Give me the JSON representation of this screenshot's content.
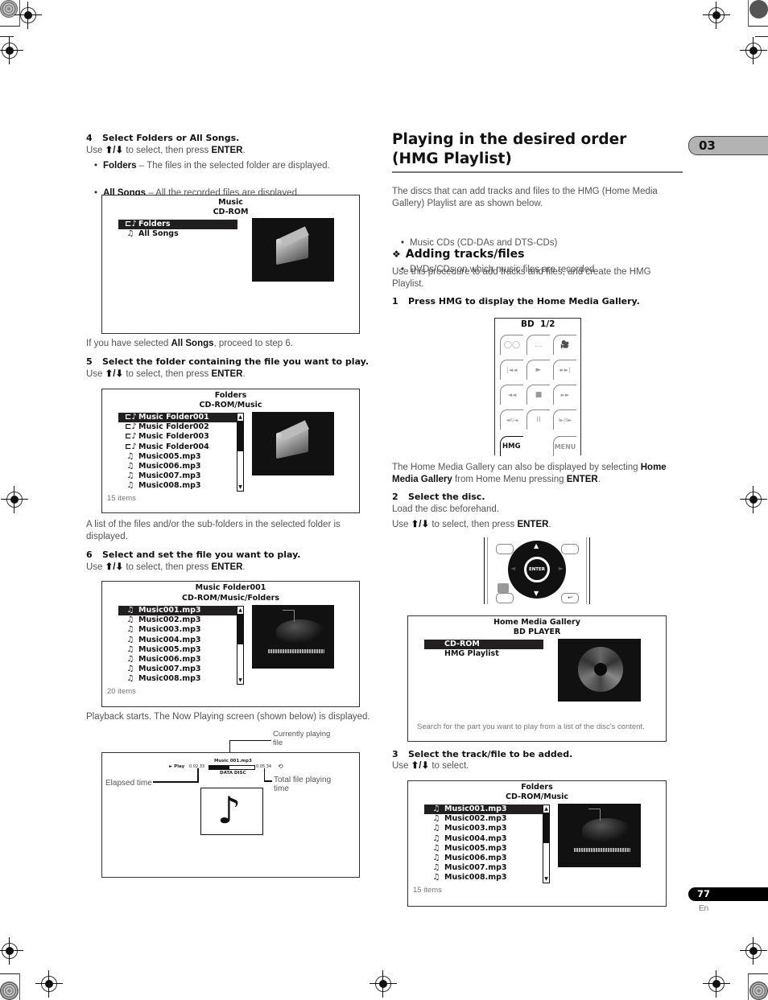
{
  "chapter_tab": "03",
  "page_number": "77",
  "page_lang": "En",
  "left": {
    "step4": {
      "num": "4",
      "title": "Select Folders or All Songs.",
      "use_pre": "Use ",
      "arrows": "⬆/⬇",
      "use_post": " to select, then press ",
      "enter": "ENTER",
      "period": ".",
      "bullets": [
        {
          "term": "Folders",
          "desc": " – The files in the selected folder are displayed."
        },
        {
          "term": "All Songs",
          "desc": " – All the recorded files are displayed."
        }
      ]
    },
    "screen1": {
      "title1": "Music",
      "title2": "CD-ROM",
      "items": [
        {
          "icon": "folder-music",
          "glyph": "🗀",
          "label": "Folders",
          "selected": true
        },
        {
          "icon": "music-note",
          "glyph": "♫",
          "label": "All Songs",
          "selected": false
        }
      ]
    },
    "note_all_songs": {
      "pre": "If you have selected ",
      "bold": "All Songs",
      "post": ", proceed to step 6."
    },
    "step5": {
      "num": "5",
      "title": "Select the folder containing the file you want to play.",
      "use_pre": "Use ",
      "arrows": "⬆/⬇",
      "use_post": " to select, then press ",
      "enter": "ENTER",
      "period": "."
    },
    "screen2": {
      "title1": "Folders",
      "title2": "CD-ROM/Music",
      "items": [
        {
          "icon": "folder-music",
          "label": "Music Folder001",
          "selected": true
        },
        {
          "icon": "folder-music",
          "label": "Music Folder002",
          "selected": false
        },
        {
          "icon": "folder-music",
          "label": "Music Folder003",
          "selected": false
        },
        {
          "icon": "folder-music",
          "label": "Music Folder004",
          "selected": false
        },
        {
          "icon": "music-note",
          "label": "Music005.mp3",
          "selected": false
        },
        {
          "icon": "music-note",
          "label": "Music006.mp3",
          "selected": false
        },
        {
          "icon": "music-note",
          "label": "Music007.mp3",
          "selected": false
        },
        {
          "icon": "music-note",
          "label": "Music008.mp3",
          "selected": false
        }
      ],
      "count": "15 items"
    },
    "note_list": "A list of the files and/or the sub-folders in the selected folder is displayed.",
    "step6": {
      "num": "6",
      "title": "Select and set the file you want to play.",
      "use_pre": "Use ",
      "arrows": "⬆/⬇",
      "use_post": " to select, then press ",
      "enter": "ENTER",
      "period": "."
    },
    "screen3": {
      "title1": "Music Folder001",
      "title2": "CD-ROM/Music/Folders",
      "items": [
        {
          "icon": "music-note",
          "label": "Music001.mp3",
          "selected": true
        },
        {
          "icon": "music-note",
          "label": "Music002.mp3",
          "selected": false
        },
        {
          "icon": "music-note",
          "label": "Music003.mp3",
          "selected": false
        },
        {
          "icon": "music-note",
          "label": "Music004.mp3",
          "selected": false
        },
        {
          "icon": "music-note",
          "label": "Music005.mp3",
          "selected": false
        },
        {
          "icon": "music-note",
          "label": "Music006.mp3",
          "selected": false
        },
        {
          "icon": "music-note",
          "label": "Music007.mp3",
          "selected": false
        },
        {
          "icon": "music-note",
          "label": "Music008.mp3",
          "selected": false
        }
      ],
      "count": "20 items"
    },
    "note_playback": "Playback starts. The Now Playing screen (shown below) is displayed.",
    "now_playing": {
      "play_label": "► Play",
      "elapsed": "0.02.33",
      "file": "Music 001.mp3",
      "total": "0.05.34",
      "disc": "DATA DISC",
      "progress_fraction": 0.44,
      "callout_file": "Currently playing file",
      "callout_elapsed": "Elapsed time",
      "callout_total": "Total file playing time"
    }
  },
  "right": {
    "heading": "Playing in the desired order (HMG Playlist)",
    "intro": "The discs that can add tracks and files to the HMG (Home Media Gallery) Playlist are as shown below.",
    "disc_bullets": [
      "Music CDs (CD-DAs and DTS-CDs)",
      "DVDs/CDs on which music files are recorded"
    ],
    "subheading_icon": "❖",
    "subheading": "Adding tracks/files",
    "sub_intro": "Use this procedure to add tracks and files, and create the HMG Playlist.",
    "step1": {
      "num": "1",
      "title": "Press HMG to display the Home Media Gallery."
    },
    "remote1": {
      "label": "BD  1/2",
      "buttons": [
        [
          "◯◯",
          "…",
          "🎥"
        ],
        [
          "|◄◄",
          "►",
          "►►|"
        ],
        [
          "◄◄",
          "■",
          "►►"
        ],
        [
          "◄II/◄",
          "II",
          "I►/II►"
        ]
      ],
      "hmg": "HMG",
      "menu": "MENU"
    },
    "note_hmg": {
      "pre": "The Home Media Gallery can also be displayed by selecting ",
      "bold1": "Home Media Gallery",
      "mid": " from Home Menu pressing ",
      "bold2": "ENTER",
      "post": "."
    },
    "step2": {
      "num": "2",
      "title": "Select the disc.",
      "load": "Load the disc beforehand.",
      "use_pre": "Use ",
      "arrows": "⬆/⬇",
      "use_post": " to select, then press ",
      "enter": "ENTER",
      "period": "."
    },
    "remote2": {
      "enter": "ENTER",
      "return": "↩"
    },
    "screen4": {
      "title1": "Home Media Gallery",
      "title2": "BD PLAYER",
      "items": [
        {
          "label": "CD-ROM",
          "selected": true
        },
        {
          "label": "HMG Playlist",
          "selected": false
        }
      ],
      "hint": "Search for the part you want to play from a list of the disc's content."
    },
    "step3": {
      "num": "3",
      "title": "Select the track/file to be added.",
      "use_pre": "Use ",
      "arrows": "⬆/⬇",
      "use_post": " to select."
    },
    "screen5": {
      "title1": "Folders",
      "title2": "CD-ROM/Music",
      "items": [
        {
          "icon": "music-note",
          "label": "Music001.mp3",
          "selected": true
        },
        {
          "icon": "music-note",
          "label": "Music002.mp3",
          "selected": false
        },
        {
          "icon": "music-note",
          "label": "Music003.mp3",
          "selected": false
        },
        {
          "icon": "music-note",
          "label": "Music004.mp3",
          "selected": false
        },
        {
          "icon": "music-note",
          "label": "Music005.mp3",
          "selected": false
        },
        {
          "icon": "music-note",
          "label": "Music006.mp3",
          "selected": false
        },
        {
          "icon": "music-note",
          "label": "Music007.mp3",
          "selected": false
        },
        {
          "icon": "music-note",
          "label": "Music008.mp3",
          "selected": false
        }
      ],
      "count": "15 items"
    }
  },
  "colors": {
    "selection": "#231f20",
    "chapter_tab": "#b3b3b3",
    "page_tab": "#000000",
    "body_text": "#555555"
  }
}
